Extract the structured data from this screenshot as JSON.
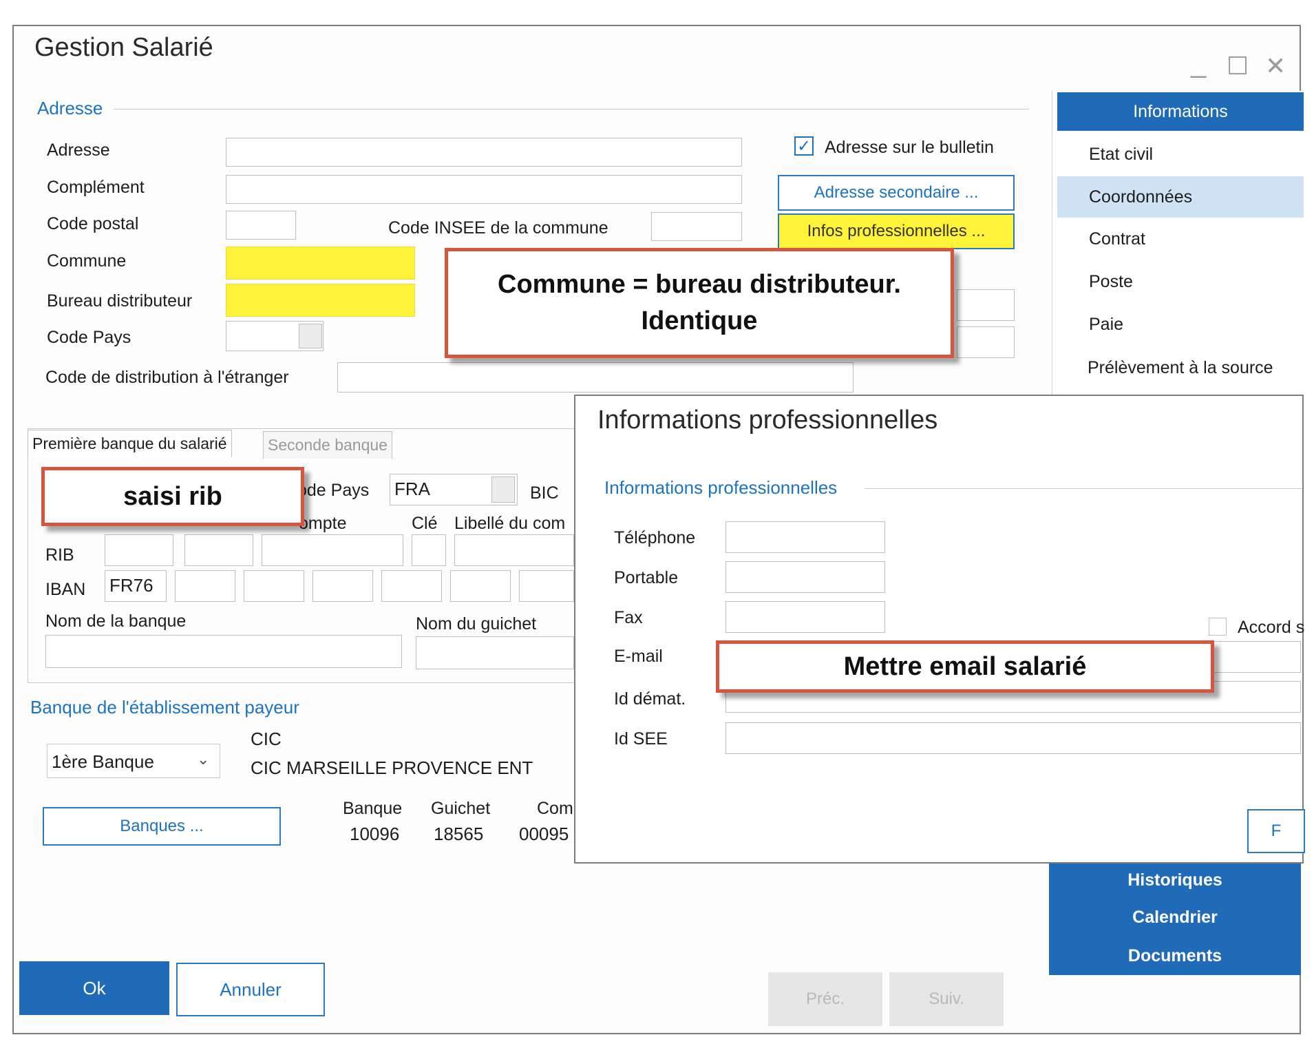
{
  "window": {
    "title": "Gestion Salarié",
    "controls": {
      "minimize": "_",
      "maximize": "☐",
      "close": "✕"
    }
  },
  "address": {
    "section_title": "Adresse",
    "labels": {
      "adresse": "Adresse",
      "complement": "Complément",
      "code_postal": "Code postal",
      "code_insee": "Code INSEE de la commune",
      "commune": "Commune",
      "bureau": "Bureau distributeur",
      "code_pays": "Code Pays",
      "code_distribution": "Code de distribution à l'étranger"
    },
    "checkbox_label": "Adresse sur le bulletin",
    "checkbox_checked": true,
    "btn_secondary": "Adresse secondaire ...",
    "btn_infos_pro": "Infos professionnelles ..."
  },
  "nav": {
    "header": "Informations",
    "items": [
      "Etat civil",
      "Coordonnées",
      "Contrat",
      "Poste",
      "Paie",
      "Prélèvement à la source"
    ],
    "selected": "Coordonnées",
    "bottom": [
      "Historiques",
      "Calendrier",
      "Documents"
    ]
  },
  "bank": {
    "tabs": [
      "Première banque du salarié",
      "Seconde banque"
    ],
    "code_pays_label": "ode Pays",
    "code_pays_value": "FRA",
    "bic_label": "BIC",
    "col_compte": "ompte",
    "col_cle": "Clé",
    "col_libelle": "Libellé du com",
    "rib_label": "RIB",
    "iban_label": "IBAN",
    "iban_prefix": "FR76",
    "nom_banque_label": "Nom de la banque",
    "nom_guichet_label": "Nom du guichet"
  },
  "payer_bank": {
    "section_title": "Banque de l'établissement payeur",
    "select_value": "1ère Banque",
    "bank_short": "CIC",
    "bank_name": "CIC MARSEILLE PROVENCE ENT",
    "btn_banques": "Banques ...",
    "col_banque": "Banque",
    "col_guichet": "Guichet",
    "col_compte": "Com",
    "val_banque": "10096",
    "val_guichet": "18565",
    "val_compte": "00095"
  },
  "dialog": {
    "title": "Informations professionnelles",
    "section_title": "Informations professionnelles",
    "labels": {
      "telephone": "Téléphone",
      "portable": "Portable",
      "fax": "Fax",
      "email": "E-mail",
      "id_demat": "Id démat.",
      "id_see": "Id SEE"
    },
    "accord_label": "Accord s",
    "btn_partial": "F"
  },
  "footer": {
    "ok": "Ok",
    "annuler": "Annuler",
    "prec": "Préc.",
    "suiv": "Suiv."
  },
  "callouts": {
    "commune_line1": "Commune = bureau distributeur.",
    "commune_line2": "Identique",
    "rib": "saisi rib",
    "email": "Mettre email salarié"
  },
  "colors": {
    "accent": "#1f6bb8",
    "highlight": "#fff33a",
    "callout_border": "#d9543f"
  }
}
